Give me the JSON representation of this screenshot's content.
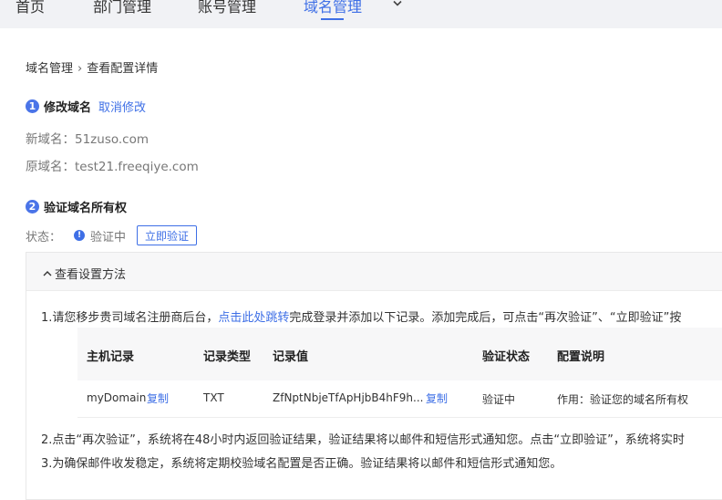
{
  "nav": {
    "items": [
      {
        "label": "首页"
      },
      {
        "label": "部门管理"
      },
      {
        "label": "账号管理"
      },
      {
        "label": "域名管理"
      }
    ],
    "active": "域名管理"
  },
  "breadcrumb": {
    "parent": "域名管理",
    "separator": "›",
    "current": "查看配置详情"
  },
  "step1": {
    "number": "1",
    "title": "修改域名",
    "cancel_link": "取消修改",
    "new_domain_label": "新域名：",
    "new_domain_value": "51zuso.com",
    "old_domain_label": "原域名：",
    "old_domain_value": "test21.freeqiye.com"
  },
  "step2": {
    "number": "2",
    "title": "验证域名所有权",
    "status_label": "状态：",
    "status_value": "验证中",
    "verify_button": "立即验证"
  },
  "panel": {
    "title": "查看设置方法",
    "line1_prefix": "1.请您移步贵司域名注册商后台，",
    "line1_link": "点击此处跳转",
    "line1_suffix": "完成登录并添加以下记录。添加完成后，可点击“再次验证”、“立即验证”按",
    "line2": "2.点击“再次验证”，系统将在48小时内返回验证结果，验证结果将以邮件和短信形式通知您。点击“立即验证”，系统将实时",
    "line3": "3.为确保邮件收发稳定，系统将定期校验域名配置是否正确。验证结果将以邮件和短信形式通知您。"
  },
  "table": {
    "headers": [
      "主机记录",
      "记录类型",
      "记录值",
      "验证状态",
      "配置说明"
    ],
    "rows": [
      {
        "host": "myDomain",
        "host_copy": "复制",
        "type": "TXT",
        "value": "ZfNptNbjeTfApHjbB4hF9h...",
        "value_copy": "复制",
        "status": "验证中",
        "note": "作用：验证您的域名所有权"
      }
    ]
  },
  "colors": {
    "accent": "#3e6fe6",
    "nav_bg": "#f1f2f5",
    "header_bg": "#f7f7f8"
  }
}
